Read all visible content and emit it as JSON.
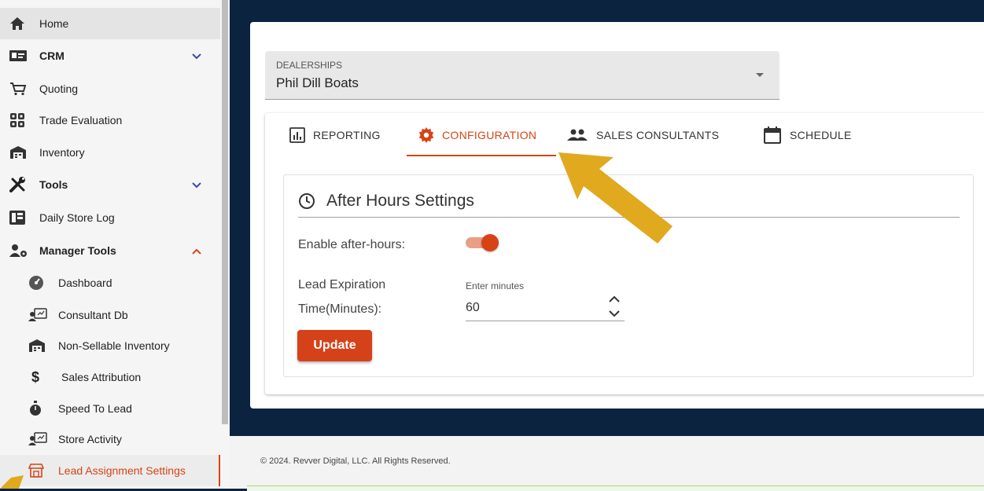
{
  "sidebar": {
    "items": [
      {
        "label": "Home",
        "icon": "home-icon"
      },
      {
        "label": "CRM",
        "icon": "id-card-icon"
      },
      {
        "label": "Quoting",
        "icon": "cart-icon"
      },
      {
        "label": "Trade Evaluation",
        "icon": "grid-icon"
      },
      {
        "label": "Inventory",
        "icon": "warehouse-icon"
      },
      {
        "label": "Tools",
        "icon": "tools-icon"
      },
      {
        "label": "Daily Store Log",
        "icon": "log-icon"
      },
      {
        "label": "Manager Tools",
        "icon": "manager-icon"
      }
    ],
    "sub_items": [
      {
        "label": "Dashboard",
        "icon": "dashboard-icon"
      },
      {
        "label": "Consultant Db",
        "icon": "consultant-icon"
      },
      {
        "label": "Non-Sellable Inventory",
        "icon": "warehouse-icon"
      },
      {
        "label": "Sales Attribution",
        "icon": "dollar-icon"
      },
      {
        "label": "Speed To Lead",
        "icon": "stopwatch-icon"
      },
      {
        "label": "Store Activity",
        "icon": "consultant-icon"
      },
      {
        "label": "Lead Assignment Settings",
        "icon": "store-icon"
      }
    ]
  },
  "dealer": {
    "label": "DEALERSHIPS",
    "value": "Phil Dill Boats"
  },
  "tabs": [
    {
      "label": "REPORTING",
      "icon": "chart-icon"
    },
    {
      "label": "CONFIGURATION",
      "icon": "cog-icon"
    },
    {
      "label": "SALES CONSULTANTS",
      "icon": "people-icon"
    },
    {
      "label": "SCHEDULE",
      "icon": "calendar-icon"
    }
  ],
  "settings": {
    "title": "After Hours Settings",
    "enable_label": "Enable after-hours:",
    "enable_on": true,
    "lead_label_line1": "Lead Expiration",
    "lead_label_line2": "Time(Minutes):",
    "minutes_label": "Enter minutes",
    "minutes_value": "60",
    "update_label": "Update"
  },
  "footer": {
    "text": "© 2024. Revver Digital, LLC. All Rights Reserved."
  },
  "colors": {
    "accent": "#d84315",
    "arrow": "#e0a91e",
    "background": "#0c2340"
  }
}
